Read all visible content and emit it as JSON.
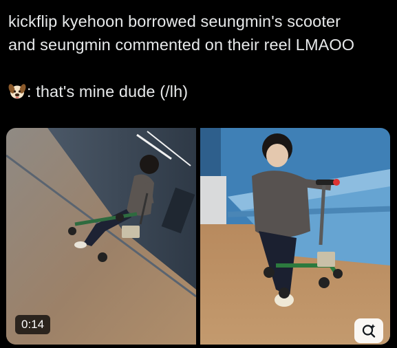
{
  "post": {
    "line1": "kickflip kyehoon borrowed seungmin's scooter",
    "line2": "and seungmin commented on their reel LMAOO",
    "quote": ": that's mine dude (/lh)",
    "quote_emoji": "puppy-face-emoji"
  },
  "media": {
    "video_duration": "0:14",
    "lens_icon": "visual-search-icon"
  }
}
